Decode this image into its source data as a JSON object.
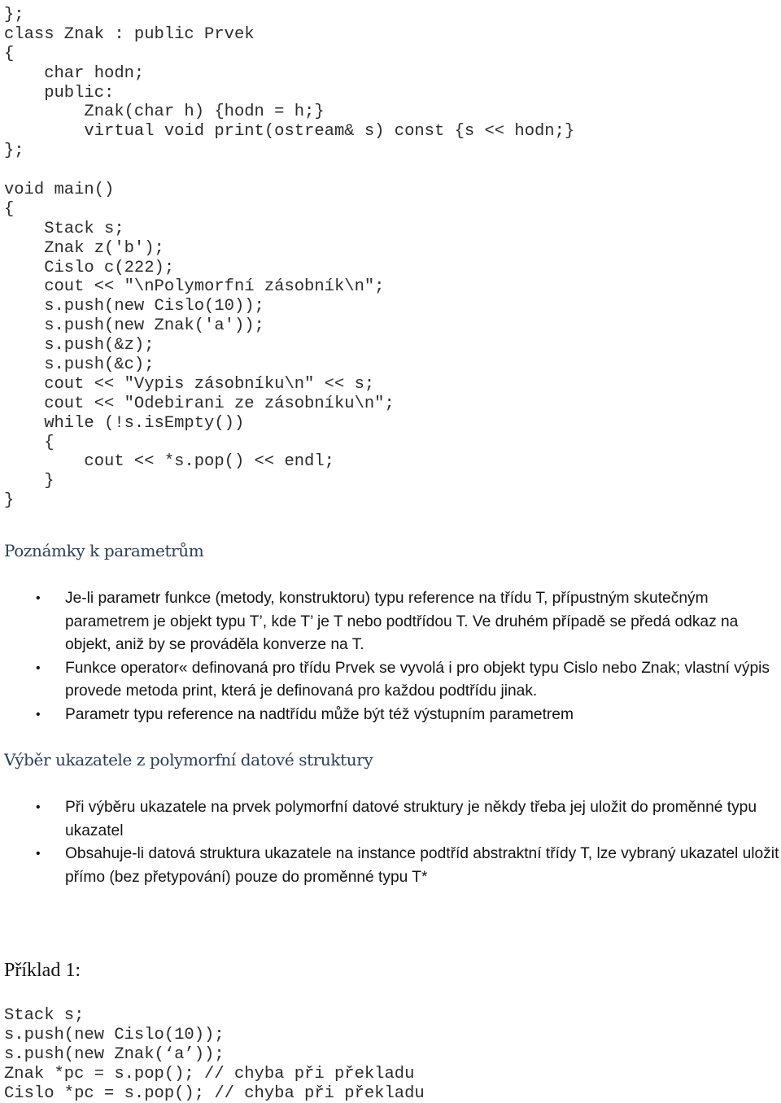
{
  "code_block_1": {
    "lines": [
      "};",
      "class Znak : public Prvek",
      "{",
      "    char hodn;",
      "    public:",
      "        Znak(char h) {hodn = h;}",
      "        virtual void print(ostream& s) const {s << hodn;}",
      "};",
      "",
      "void main()",
      "{",
      "    Stack s;",
      "    Znak z('b');",
      "    Cislo c(222);",
      "    cout << \"\\nPolymorfní zásobník\\n\";",
      "    s.push(new Cislo(10));",
      "    s.push(new Znak('a'));",
      "    s.push(&z);",
      "    s.push(&c);",
      "    cout << \"Vypis zásobníku\\n\" << s;",
      "    cout << \"Odebirani ze zásobníku\\n\";",
      "    while (!s.isEmpty())",
      "    {",
      "        cout << *s.pop() << endl;",
      "    }",
      "}"
    ]
  },
  "section_parameters": {
    "heading": "Poznámky k parametrům",
    "bullets": [
      "Je-li parametr funkce (metody, konstruktoru) typu reference na třídu T, přípustným skutečným parametrem je objekt typu T’, kde T’ je T nebo podtřídou T. Ve druhém případě se předá odkaz na objekt, aniž by se prováděla konverze na T.",
      "Funkce operator« definovaná pro třídu Prvek se vyvolá i pro objekt typu Cislo nebo Znak; vlastní výpis provede metoda print, která je definovaná pro každou podtřídu jinak.",
      "Parametr typu reference na nadtřídu může být též výstupním parametrem"
    ]
  },
  "section_pointer_selection": {
    "heading": "Výběr ukazatele z polymorfní datové struktury",
    "bullets": [
      "Při výběru ukazatele na prvek polymorfní datové struktury je někdy třeba jej uložit do proměnné typu ukazatel",
      "Obsahuje-li datová struktura ukazatele na instance podtříd abstraktní třídy T, lze vybraný ukazatel uložit přímo (bez přetypování) pouze do proměnné typu T*"
    ]
  },
  "example_1": {
    "title": "Příklad 1:",
    "lines": [
      "Stack s;",
      "s.push(new Cislo(10));",
      "s.push(new Znak(‘a’));",
      "Znak *pc = s.pop(); // chyba při překladu",
      "Cislo *pc = s.pop(); // chyba při překladu"
    ]
  },
  "bullet_glyph": "•"
}
